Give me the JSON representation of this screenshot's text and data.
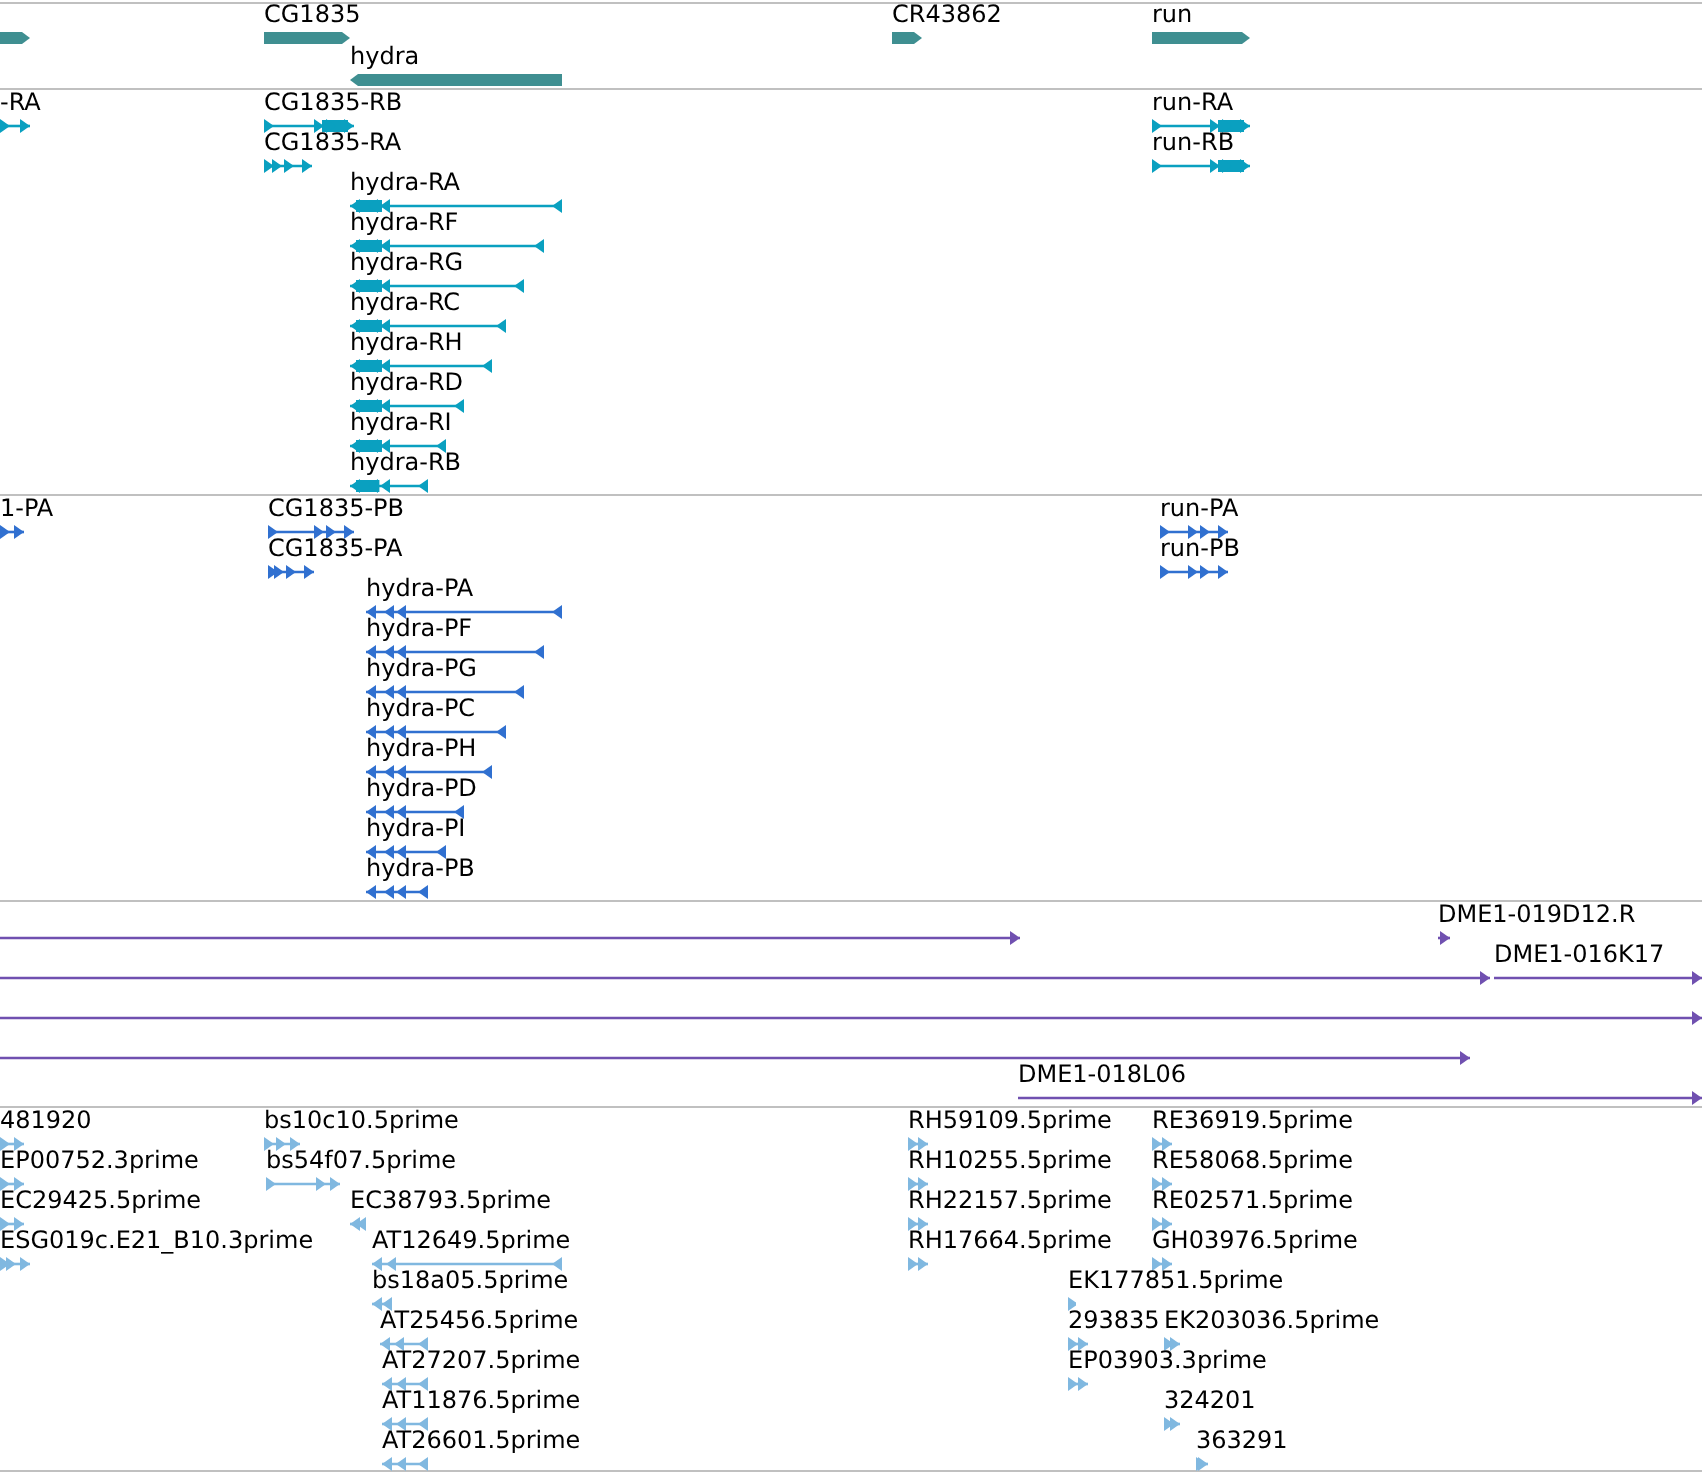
{
  "tracks": [
    {
      "kind": "gene",
      "color": "#3f8f91",
      "features": [
        {
          "reverse": false
        },
        {
          "label": "CG1835",
          "reverse": false
        },
        {
          "label": "hydra",
          "reverse": true
        },
        {
          "label": "CR43862",
          "reverse": false
        },
        {
          "label": "run",
          "reverse": false
        }
      ]
    },
    {
      "kind": "transcript",
      "color": "#0aa0c0",
      "features": [
        {
          "label": "-RA",
          "reverse": false
        },
        {
          "label": "CG1835-RB",
          "reverse": false
        },
        {
          "label": "CG1835-RA",
          "reverse": false
        },
        {
          "label": "hydra-RA",
          "reverse": true
        },
        {
          "label": "hydra-RF",
          "reverse": true
        },
        {
          "label": "hydra-RG",
          "reverse": true
        },
        {
          "label": "hydra-RC",
          "reverse": true
        },
        {
          "label": "hydra-RH",
          "reverse": true
        },
        {
          "label": "hydra-RD",
          "reverse": true
        },
        {
          "label": "hydra-RI",
          "reverse": true
        },
        {
          "label": "hydra-RB",
          "reverse": true
        },
        {
          "label": "run-RA",
          "reverse": false
        },
        {
          "label": "run-RB",
          "reverse": false
        }
      ]
    },
    {
      "kind": "protein",
      "color": "#3070d0",
      "features": [
        {
          "label": "1-PA",
          "reverse": false
        },
        {
          "label": "CG1835-PB",
          "reverse": false
        },
        {
          "label": "CG1835-PA",
          "reverse": false
        },
        {
          "label": "hydra-PA",
          "reverse": true
        },
        {
          "label": "hydra-PF",
          "reverse": true
        },
        {
          "label": "hydra-PG",
          "reverse": true
        },
        {
          "label": "hydra-PC",
          "reverse": true
        },
        {
          "label": "hydra-PH",
          "reverse": true
        },
        {
          "label": "hydra-PD",
          "reverse": true
        },
        {
          "label": "hydra-PI",
          "reverse": true
        },
        {
          "label": "hydra-PB",
          "reverse": true
        },
        {
          "label": "run-PA",
          "reverse": false
        },
        {
          "label": "run-PB",
          "reverse": false
        }
      ]
    },
    {
      "kind": "clone",
      "color": "#7050b0",
      "features": [
        {
          "reverse": false
        },
        {
          "label": "DME1-019D12.R",
          "reverse": false
        },
        {
          "reverse": false
        },
        {
          "label": "DME1-016K17",
          "reverse": false
        },
        {
          "reverse": false
        },
        {
          "reverse": false
        },
        {
          "label": "DME1-018L06",
          "reverse": false
        }
      ]
    },
    {
      "kind": "est",
      "color": "#80b8e0",
      "features": [
        {
          "label": "481920",
          "reverse": false
        },
        {
          "label": "EP00752.3prime",
          "reverse": false
        },
        {
          "label": "EC29425.5prime",
          "reverse": false
        },
        {
          "label": "ESG019c.E21_B10.3prime",
          "reverse": false
        },
        {
          "label": "bs10c10.5prime",
          "reverse": false
        },
        {
          "label": "bs54f07.5prime",
          "reverse": false
        },
        {
          "label": "EC38793.5prime",
          "reverse": true
        },
        {
          "label": "AT12649.5prime",
          "reverse": true
        },
        {
          "label": "bs18a05.5prime",
          "reverse": true
        },
        {
          "label": "AT25456.5prime",
          "reverse": true
        },
        {
          "label": "AT27207.5prime",
          "reverse": true
        },
        {
          "label": "AT11876.5prime",
          "reverse": true
        },
        {
          "label": "AT26601.5prime",
          "reverse": true
        },
        {
          "label": "RH59109.5prime",
          "reverse": false
        },
        {
          "label": "RH10255.5prime",
          "reverse": false
        },
        {
          "label": "RH22157.5prime",
          "reverse": false
        },
        {
          "label": "RH17664.5prime",
          "reverse": false
        },
        {
          "label": "RE36919.5prime",
          "reverse": false
        },
        {
          "label": "RE58068.5prime",
          "reverse": false
        },
        {
          "label": "RE02571.5prime",
          "reverse": false
        },
        {
          "label": "GH03976.5prime",
          "reverse": false
        },
        {
          "label": "EK177851.5prime",
          "reverse": false
        },
        {
          "label": "293835",
          "reverse": false
        },
        {
          "label": "EK203036.5prime",
          "reverse": false
        },
        {
          "label": "EP03903.3prime",
          "reverse": false
        },
        {
          "label": "324201",
          "reverse": false
        },
        {
          "label": "363291",
          "reverse": false
        }
      ]
    }
  ]
}
